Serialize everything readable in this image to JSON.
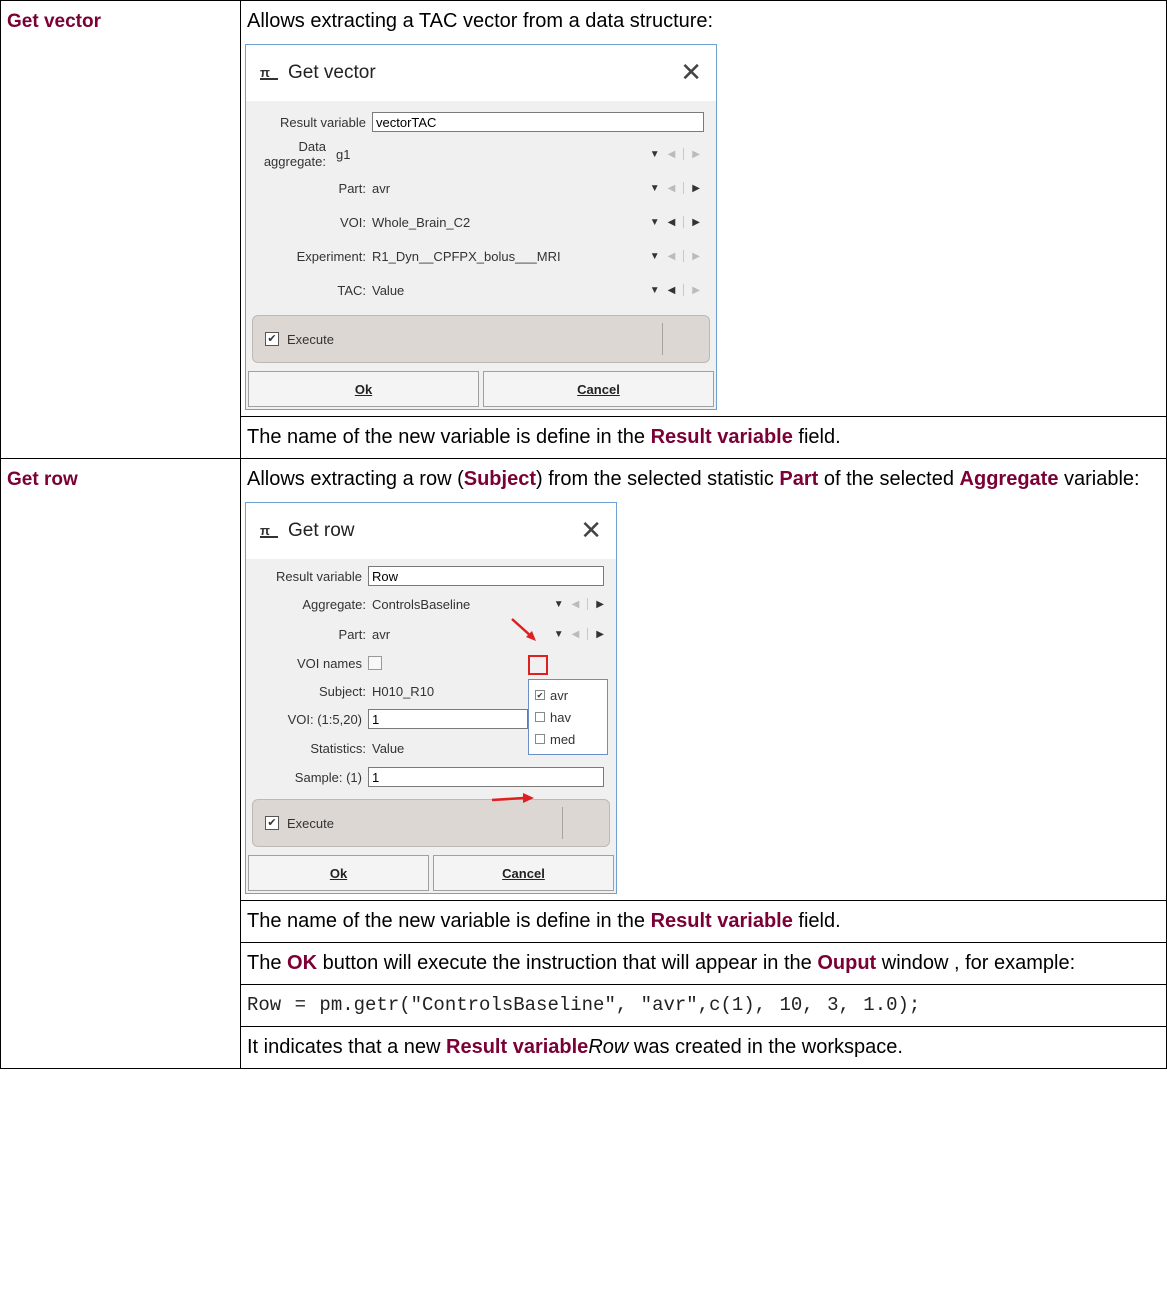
{
  "rows": [
    {
      "term": "Get vector",
      "intro": "Allows extracting a TAC vector from a data structure:",
      "dialog": {
        "title": "Get vector",
        "result_label": "Result variable",
        "result_value": "vectorTAC",
        "fields": [
          {
            "label": "Data aggregate:",
            "value": "g1"
          },
          {
            "label": "Part:",
            "value": "avr"
          },
          {
            "label": "VOI:",
            "value": "Whole_Brain_C2"
          },
          {
            "label": "Experiment:",
            "value": "R1_Dyn__CPFPX_bolus___MRI"
          },
          {
            "label": "TAC:",
            "value": "Value"
          }
        ],
        "execute_label": "Execute",
        "ok_label": "Ok",
        "cancel_label": "Cancel"
      },
      "note_pre": "The name of the new variable is define in the ",
      "note_hl": "Result variable",
      "note_post": " field."
    },
    {
      "term": "Get row",
      "intro_1": "Allows extracting a row (",
      "intro_subject": "Subject",
      "intro_2": ") from the selected statistic ",
      "intro_part": "Part",
      "intro_3": " of the selected ",
      "intro_aggregate": "Aggregate",
      "intro_4": " variable:",
      "dialog": {
        "title": "Get row",
        "result_label": "Result variable",
        "result_value": "Row",
        "aggregate_label": "Aggregate:",
        "aggregate_value": "ControlsBaseline",
        "part_label": "Part:",
        "part_value": "avr",
        "voi_names_label": "VOI names",
        "subject_label": "Subject:",
        "subject_value": "H010_R10",
        "voi_label": "VOI: (1:5,20)",
        "voi_value": "1",
        "statistics_label": "Statistics:",
        "statistics_value": "Value",
        "sample_label": "Sample: (1)",
        "sample_value": "1",
        "part_options": [
          "avr",
          "hav",
          "med"
        ],
        "execute_label": "Execute",
        "ok_label": "Ok",
        "cancel_label": "Cancel"
      },
      "note_pre": "The name of the new variable is define in the ",
      "note_hl": "Result variable",
      "note_post": " field.",
      "ok_pre": "The ",
      "ok_hl": "OK",
      "ok_mid": " button will execute the instruction that will appear in the ",
      "ok_output": "Ouput",
      "ok_post": " window , for example:",
      "code": "Row = pm.getr(\"ControlsBaseline\", \"avr\",c(1), 10, 3, 1.0);",
      "final_pre": "It indicates that a new ",
      "final_hl": "Result variable",
      "final_italic": "Row",
      "final_post": " was created in the workspace."
    }
  ]
}
